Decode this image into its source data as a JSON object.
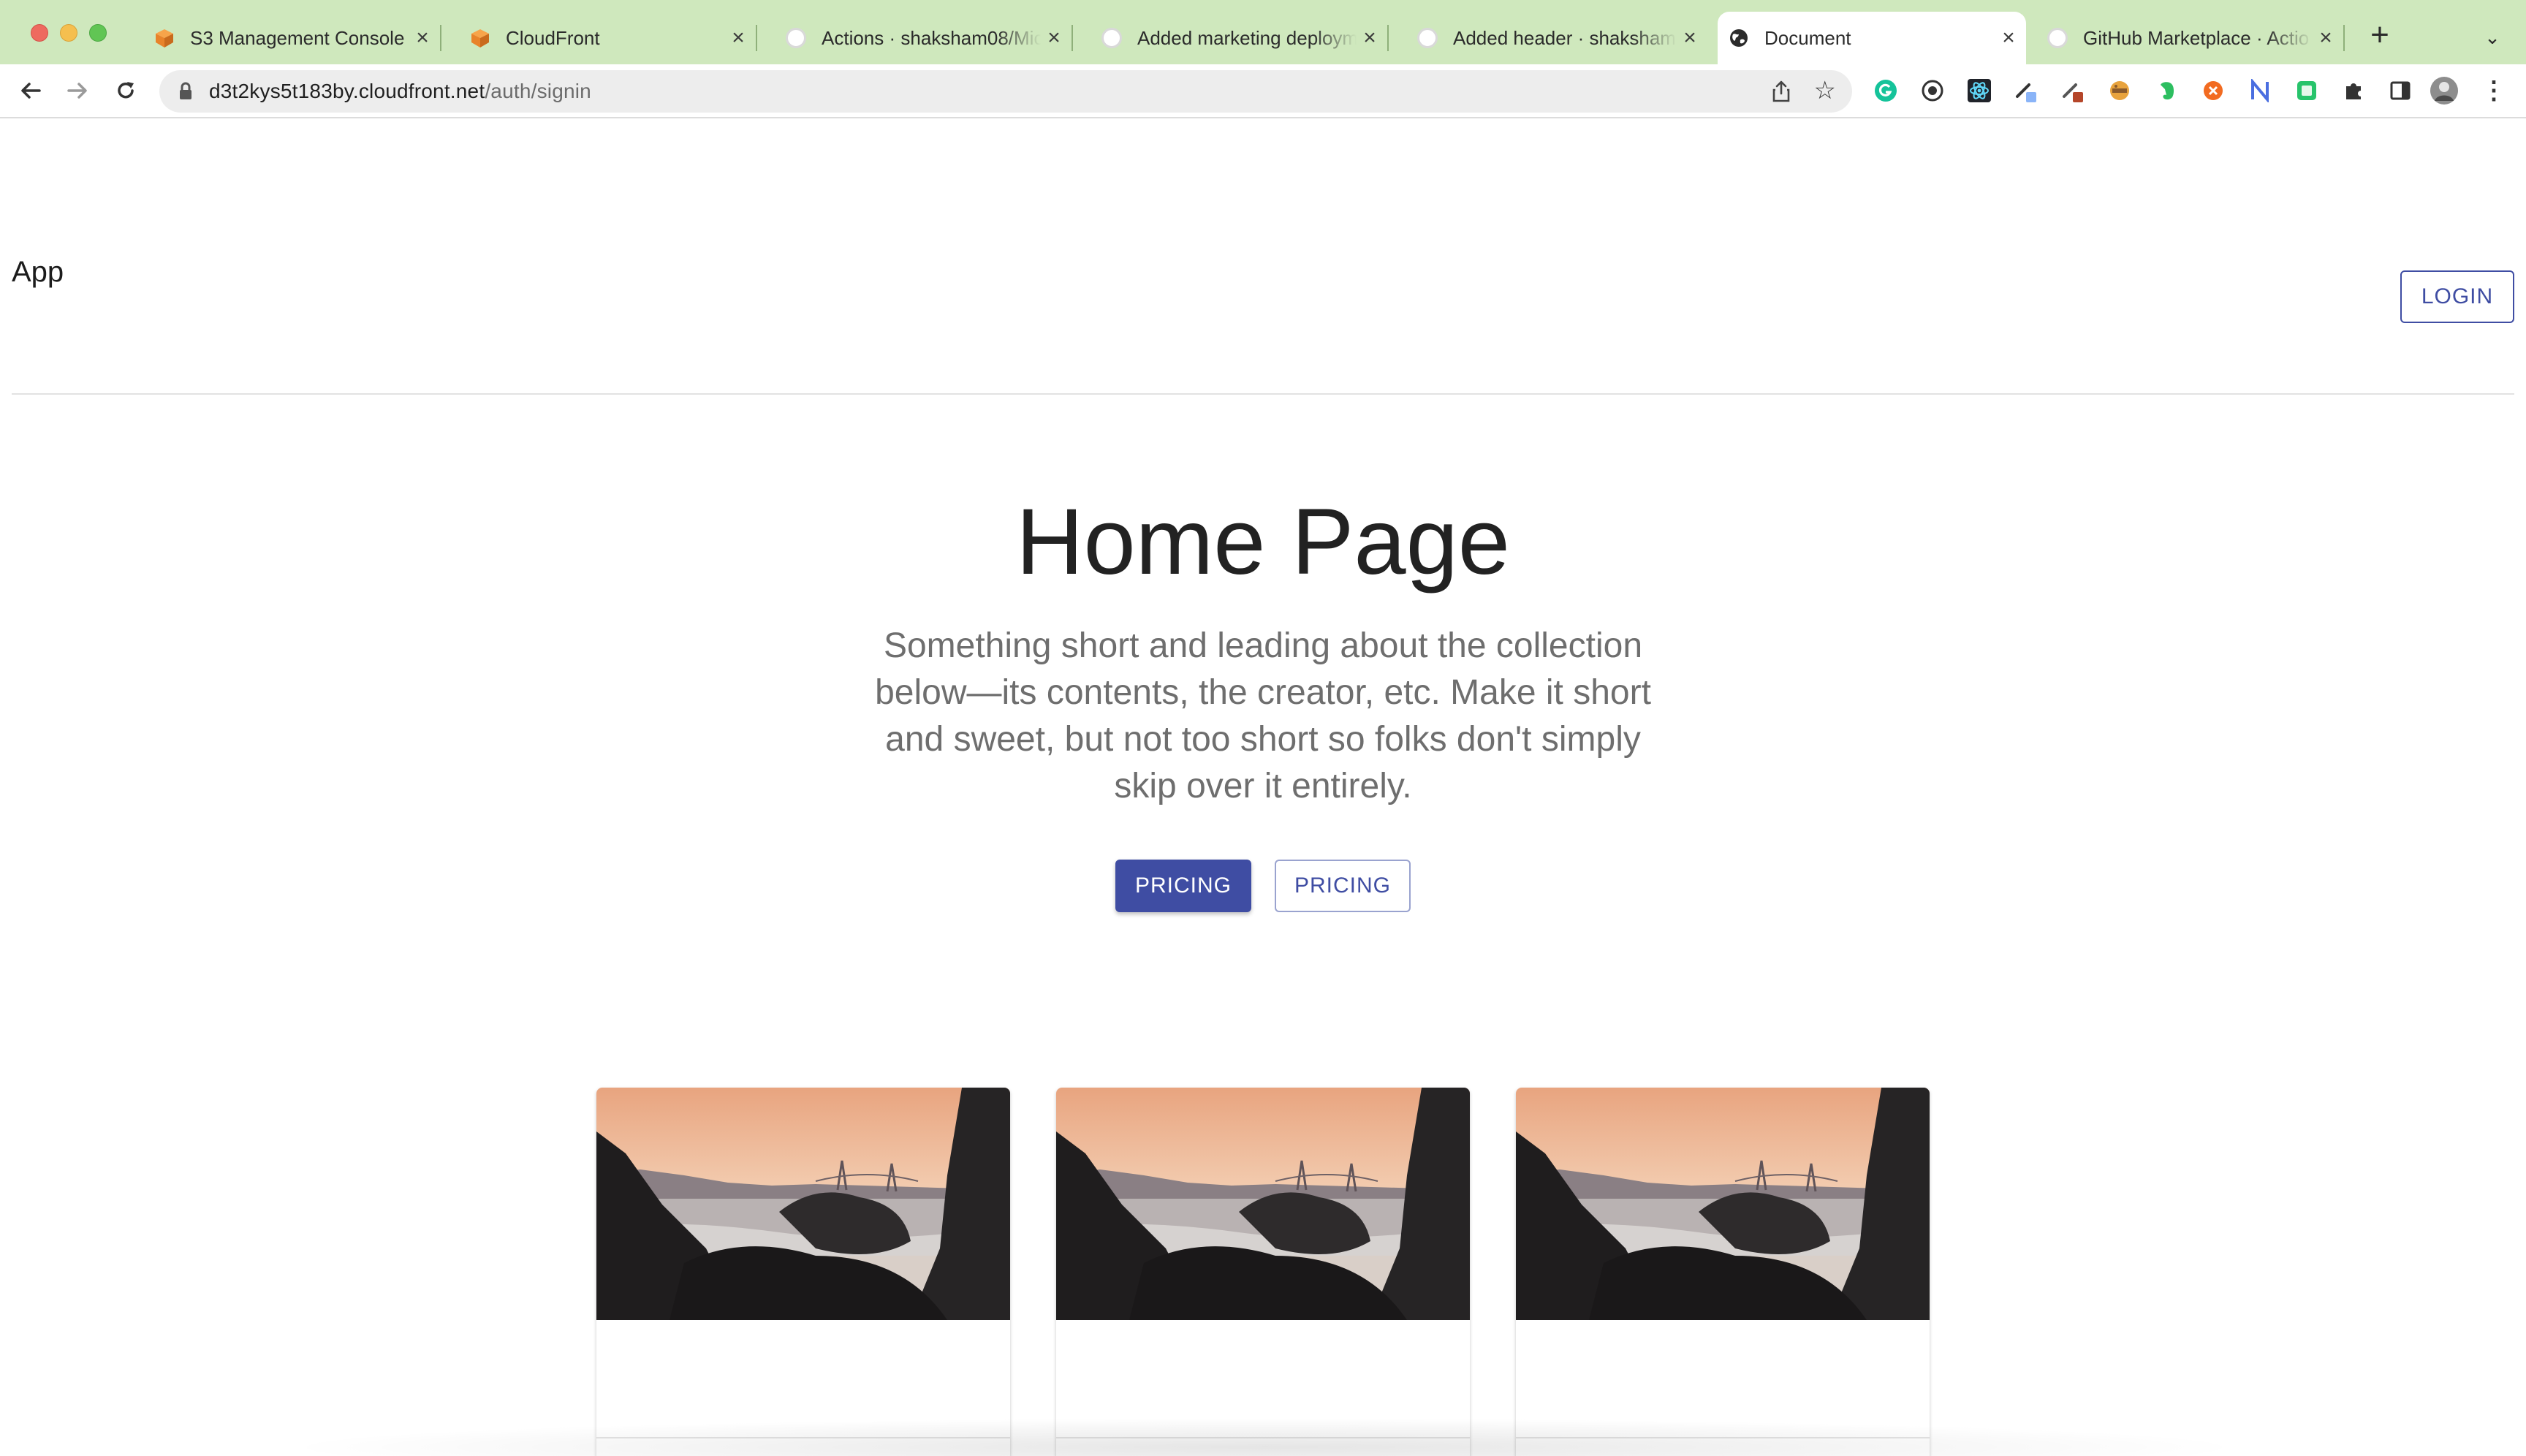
{
  "browser": {
    "tabs": [
      {
        "title": "S3 Management Console",
        "favicon": "aws-cube-icon"
      },
      {
        "title": "CloudFront",
        "favicon": "aws-cube-icon"
      },
      {
        "title": "Actions · shaksham08/Mic",
        "favicon": "github-icon"
      },
      {
        "title": "Added marketing deploym",
        "favicon": "github-icon"
      },
      {
        "title": "Added header · shaksham0",
        "favicon": "github-icon"
      },
      {
        "title": "Document",
        "favicon": "globe-icon",
        "active": true
      },
      {
        "title": "GitHub Marketplace · Actio",
        "favicon": "github-icon"
      }
    ],
    "url_host": "d3t2kys5t183by.cloudfront.net",
    "url_path": "/auth/signin",
    "colors": {
      "tabbar": "#cfe8bd",
      "accent": "#3f4da3"
    }
  },
  "header": {
    "app_title": "App",
    "login_label": "LOGIN"
  },
  "hero": {
    "title": "Home Page",
    "description": "Something short and leading about the collection below—its contents, the creator, etc. Make it short and sweet, but not too short so folks don't simply skip over it entirely.",
    "primary_button": "PRICING",
    "secondary_button": "PRICING"
  },
  "cards": [
    {
      "image": "rocky-beach-sunset-golden-gate-photo"
    },
    {
      "image": "rocky-beach-sunset-golden-gate-photo"
    },
    {
      "image": "rocky-beach-sunset-golden-gate-photo"
    }
  ]
}
